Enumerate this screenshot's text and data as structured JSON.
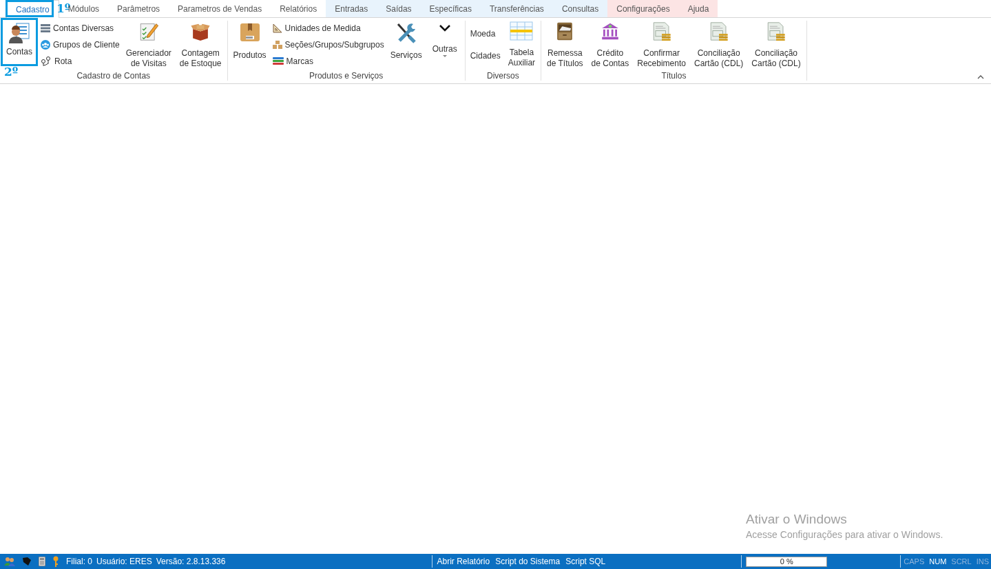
{
  "tabs": [
    {
      "label": "Cadastro",
      "selected": true,
      "annotation": "1º"
    },
    {
      "label": "Módulos",
      "selected": false
    },
    {
      "label": "Parâmetros",
      "selected": false
    },
    {
      "label": "Parametros de Vendas",
      "selected": false
    },
    {
      "label": "Relatórios",
      "selected": false
    },
    {
      "label": "Entradas",
      "selected": false,
      "color": "#e8f3fc"
    },
    {
      "label": "Saídas",
      "selected": false,
      "color": "#e8f3fc"
    },
    {
      "label": "Específicas",
      "selected": false,
      "color": "#e8f3fc"
    },
    {
      "label": "Transferências",
      "selected": false,
      "color": "#e8f3fc"
    },
    {
      "label": "Consultas",
      "selected": false,
      "color": "#e8f3fc"
    },
    {
      "label": "Configurações",
      "selected": false,
      "color": "#fce4e4"
    },
    {
      "label": "Ajuda",
      "selected": false,
      "color": "#fce4e4"
    }
  ],
  "ribbon_groups": [
    {
      "label": "Cadastro de Contas",
      "items": [
        {
          "kind": "large",
          "label": "Contas",
          "annotation": "2º"
        },
        {
          "kind": "stack",
          "items": [
            {
              "label": "Contas Diversas"
            },
            {
              "label": "Grupos de Cliente"
            },
            {
              "label": "Rota"
            }
          ]
        },
        {
          "kind": "large",
          "label": "Gerenciador\nde Visitas"
        },
        {
          "kind": "large",
          "label": "Contagem\nde Estoque"
        }
      ]
    },
    {
      "label": "Produtos e Serviços",
      "items": [
        {
          "kind": "large",
          "label": "Produtos"
        },
        {
          "kind": "stack",
          "items": [
            {
              "label": "Unidades de Medida"
            },
            {
              "label": "Seções/Grupos/Subgrupos"
            },
            {
              "label": "Marcas"
            }
          ]
        },
        {
          "kind": "large",
          "label": "Serviços"
        },
        {
          "kind": "dropdown",
          "label": "Outras"
        }
      ]
    },
    {
      "label": "Diversos",
      "items": [
        {
          "kind": "textstack",
          "items": [
            {
              "label": "Moeda"
            },
            {
              "label": "Cidades"
            }
          ]
        },
        {
          "kind": "large",
          "label": "Tabela\nAuxiliar"
        }
      ]
    },
    {
      "label": "Títulos",
      "items": [
        {
          "kind": "large",
          "label": "Remessa\nde Títulos"
        },
        {
          "kind": "large",
          "label": "Crédito\nde Contas"
        },
        {
          "kind": "large",
          "label": "Confirmar\nRecebimento"
        },
        {
          "kind": "large",
          "label": "Conciliação\nCartão (CDL)"
        },
        {
          "kind": "large",
          "label": "Conciliação\nCartão (CDL)"
        }
      ]
    }
  ],
  "activation_notice": {
    "title": "Ativar o Windows",
    "text": "Acesse Configurações para ativar o Windows."
  },
  "status_bar": {
    "info": [
      "Filial: 0",
      "Usuário: ERES",
      "Versão: 2.8.13.336"
    ],
    "links": [
      "Abrir Relatório",
      "Script do Sistema",
      "Script SQL"
    ],
    "progress": {
      "text": "0 %",
      "level": 0
    },
    "indicators": [
      {
        "label": "CAPS",
        "on": false
      },
      {
        "label": "NUM",
        "on": true
      },
      {
        "label": "SCRL",
        "on": false
      },
      {
        "label": "INS",
        "on": false
      }
    ]
  }
}
